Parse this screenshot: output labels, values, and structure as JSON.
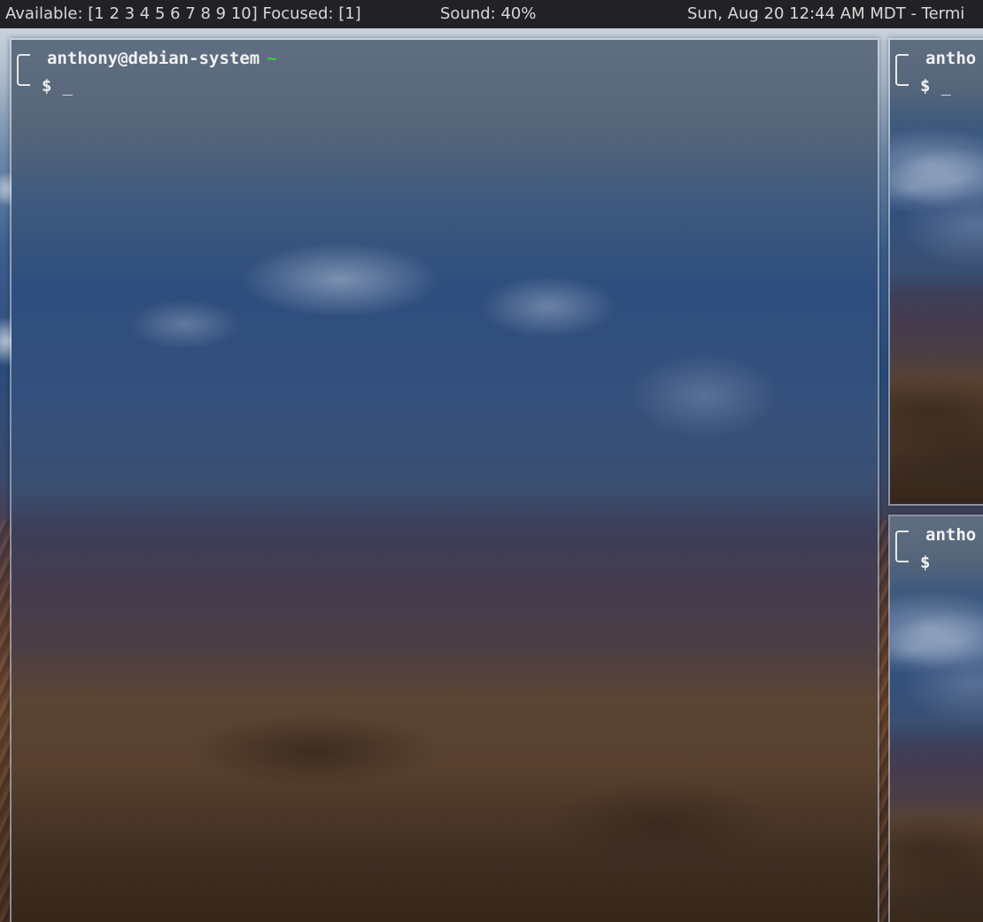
{
  "topbar": {
    "workspaces": "Available: [1 2 3 4 5 6 7 8 9 10] Focused: [1]",
    "sound": "Sound: 40%",
    "clock": "Sun, Aug 20 12:44 AM MDT - Termi"
  },
  "terminals": [
    {
      "user_host": "anthony@debian-system",
      "cwd": "~",
      "prompt_symbol": "$",
      "cursor": "_"
    },
    {
      "user_host": "antho",
      "prompt_symbol": "$",
      "cursor": "_"
    },
    {
      "user_host": "antho",
      "prompt_symbol": "$"
    }
  ],
  "colors": {
    "topbar_bg": "#222226",
    "cwd_green": "#3bd13b",
    "prompt_text": "#f2f2f2"
  }
}
